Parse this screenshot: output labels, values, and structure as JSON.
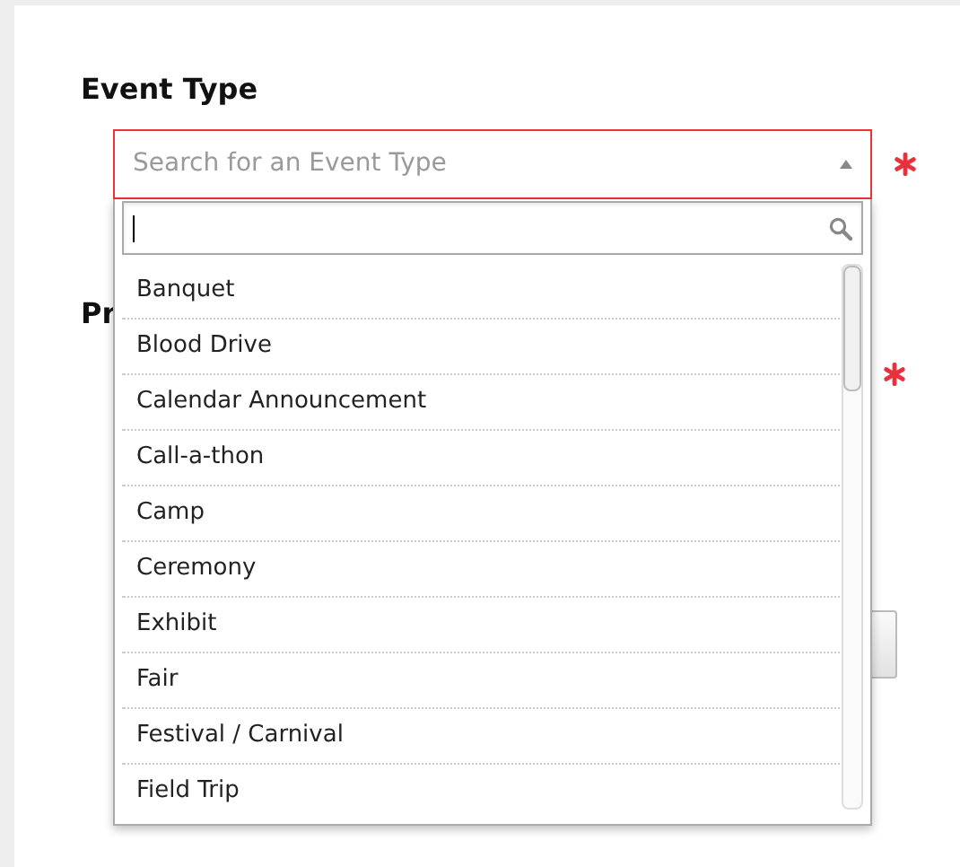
{
  "field": {
    "label": "Event Type",
    "placeholder": "Search for an Event Type",
    "required": true,
    "expanded": true
  },
  "dropdown": {
    "options": [
      {
        "label": "Banquet",
        "selected": false
      },
      {
        "label": "Blood Drive",
        "selected": false
      },
      {
        "label": "Calendar Announcement",
        "selected": false
      },
      {
        "label": "Call-a-thon",
        "selected": false
      },
      {
        "label": "Camp",
        "selected": false
      },
      {
        "label": "Ceremony",
        "selected": false
      },
      {
        "label": "Exhibit",
        "selected": false
      },
      {
        "label": "Fair",
        "selected": false
      },
      {
        "label": "Festival / Carnival",
        "selected": false
      },
      {
        "label": "Field Trip",
        "selected": false
      }
    ]
  },
  "next_field": {
    "label": "Pr",
    "required": true
  }
}
